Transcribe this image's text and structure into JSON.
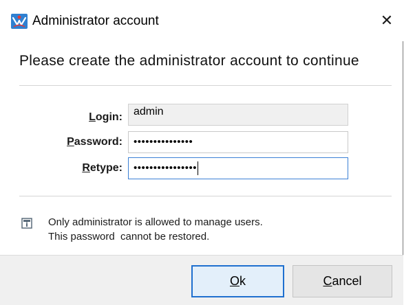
{
  "window": {
    "title": "Administrator account",
    "close_glyph": "✕"
  },
  "heading": "Please create the administrator account to continue",
  "form": {
    "login": {
      "label_first": "L",
      "label_rest": "ogin:",
      "value": "admin",
      "readonly": true
    },
    "password": {
      "label_first": "P",
      "label_rest": "assword:",
      "value": "•••••••••••••••"
    },
    "retype": {
      "label_first": "R",
      "label_rest": "etype:",
      "value": "••••••••••••••••"
    }
  },
  "info": {
    "icon": "info-icon",
    "line1": "Only administrator is allowed to manage users.",
    "line2": "This password  cannot be restored."
  },
  "buttons": {
    "ok": {
      "first": "O",
      "rest": "k"
    },
    "cancel": {
      "first": "C",
      "rest": "ancel"
    }
  },
  "colors": {
    "accent": "#1e6fcf",
    "footer_bg": "#f0f0f0",
    "readonly_bg": "#f0f0f0"
  }
}
